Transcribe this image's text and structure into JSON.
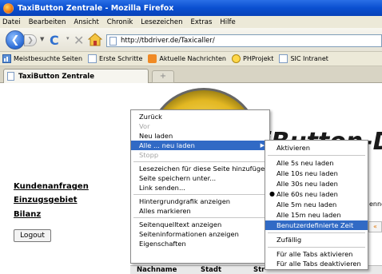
{
  "window": {
    "title": "TaxiButton Zentrale - Mozilla Firefox"
  },
  "menubar": {
    "items": [
      "Datei",
      "Bearbeiten",
      "Ansicht",
      "Chronik",
      "Lesezeichen",
      "Extras",
      "Hilfe"
    ]
  },
  "navbar": {
    "url": "http://tbdriver.de/Taxicaller/"
  },
  "bookmarks": {
    "items": [
      "Meistbesuchte Seiten",
      "Erste Schritte",
      "Aktuelle Nachrichten",
      "PHProjekt",
      "SIC Intranet"
    ]
  },
  "tabs": {
    "active_label": "TaxiButton Zentrale",
    "new_tab_symbol": "+"
  },
  "page": {
    "logo_text": "iButton-D",
    "nav_links": [
      "Kundenanfragen",
      "Einzugsgebiet",
      "Bilanz"
    ],
    "logout_label": "Logout",
    "right_fragment_1": "enne",
    "right_fragment_2": "ner",
    "table_headers": [
      "Nachname",
      "Stadt",
      "Str"
    ]
  },
  "context_menu": {
    "items": [
      {
        "label": "Zurück",
        "disabled": false
      },
      {
        "label": "Vor",
        "disabled": true
      },
      {
        "label": "Neu laden",
        "disabled": false
      },
      {
        "label": "Alle ... neu laden",
        "disabled": false,
        "highlighted": true,
        "submenu": true
      },
      {
        "label": "Stopp",
        "disabled": true
      },
      {
        "label": "Lesezeichen für diese Seite hinzufügen",
        "disabled": false
      },
      {
        "label": "Seite speichern unter...",
        "disabled": false
      },
      {
        "label": "Link senden...",
        "disabled": false
      },
      {
        "label": "Hintergrundgrafik anzeigen",
        "disabled": false
      },
      {
        "label": "Alles markieren",
        "disabled": false
      },
      {
        "label": "Seitenquelltext anzeigen",
        "disabled": false
      },
      {
        "label": "Seiteninformationen anzeigen",
        "disabled": false
      },
      {
        "label": "Eigenschaften",
        "disabled": false
      }
    ]
  },
  "submenu": {
    "items": [
      {
        "label": "Aktivieren"
      },
      {
        "label": "Alle 5s neu laden"
      },
      {
        "label": "Alle 10s neu laden"
      },
      {
        "label": "Alle 30s neu laden"
      },
      {
        "label": "Alle 60s neu laden",
        "checked": true
      },
      {
        "label": "Alle 5m neu laden"
      },
      {
        "label": "Alle 15m neu laden"
      },
      {
        "label": "Benutzerdefinierte Zeit",
        "highlighted": true
      },
      {
        "label": "Zufällig"
      },
      {
        "label": "Für alle Tabs aktivieren"
      },
      {
        "label": "Für alle Tabs deaktivieren"
      }
    ]
  },
  "colors": {
    "titlebar": "#0a4fd0",
    "highlight": "#316ac5",
    "menubar_bg": "#ece9d8"
  }
}
